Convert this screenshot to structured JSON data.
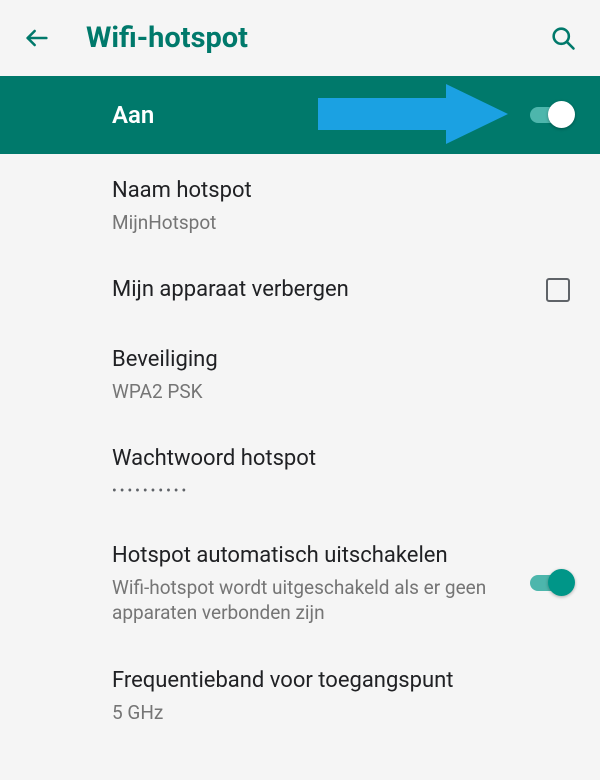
{
  "header": {
    "title": "Wifi-hotspot"
  },
  "master": {
    "label": "Aan"
  },
  "rows": {
    "name": {
      "title": "Naam hotspot",
      "value": "MijnHotspot"
    },
    "hide": {
      "title": "Mijn apparaat verbergen"
    },
    "security": {
      "title": "Beveiliging",
      "value": "WPA2 PSK"
    },
    "password": {
      "title": "Wachtwoord hotspot",
      "value": "••••••••••"
    },
    "auto_off": {
      "title": "Hotspot automatisch uitschakelen",
      "sub": "Wifi-hotspot wordt uitgeschakeld als er geen apparaten verbonden zijn"
    },
    "band": {
      "title": "Frequentieband voor toegangspunt",
      "value": "5 GHz"
    }
  }
}
